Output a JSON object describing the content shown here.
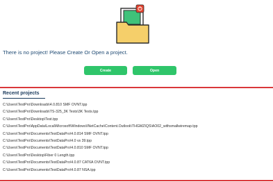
{
  "empty_state": {
    "message": "There is no project! Please Create Or Open a project."
  },
  "actions": {
    "create_label": "Create",
    "open_label": "Open"
  },
  "recent": {
    "title": "Recent projects",
    "items": [
      "C:\\Users\\TestPro\\Downloads\\4.0.810 SMF OVNT.tpp",
      "C:\\Users\\TestPro\\Downloads\\TS-325_3K Tests\\3K Tests.tpp",
      "C:\\Users\\TestPro\\Desktop\\Test.tpp",
      "C:\\Users\\TestPro\\AppData\\Local\\Microsoft\\Windows\\INetCache\\Content.Outlook\\THGMZIQS\\AO02_withsmallwiremap.tpp",
      "C:\\Users\\TestPro\\Documents\\TestDataPro\\4.0.814 SMF OVNT.tpp",
      "C:\\Users\\TestPro\\Documents\\TestDataPro\\4.0 vs 39.tpp",
      "C:\\Users\\TestPro\\Documents\\TestDataPro\\4.0.810 SMF OVNT.tpp",
      "C:\\Users\\TestPro\\Desktop\\Fiber 0 Length.tpp",
      "C:\\Users\\TestPro\\Documents\\TestDataPro\\4.0.87 CAT6A OVNT.tpp",
      "C:\\Users\\TestPro\\Documents\\TestDataPro\\4.0.87 NSA.tpp"
    ]
  },
  "colors": {
    "accent_green": "#2fc56a",
    "divider_red": "#d9373a",
    "heading_blue": "#1a3a5c",
    "folder_yellow": "#f5cf6a",
    "badge_red": "#e3432f"
  }
}
